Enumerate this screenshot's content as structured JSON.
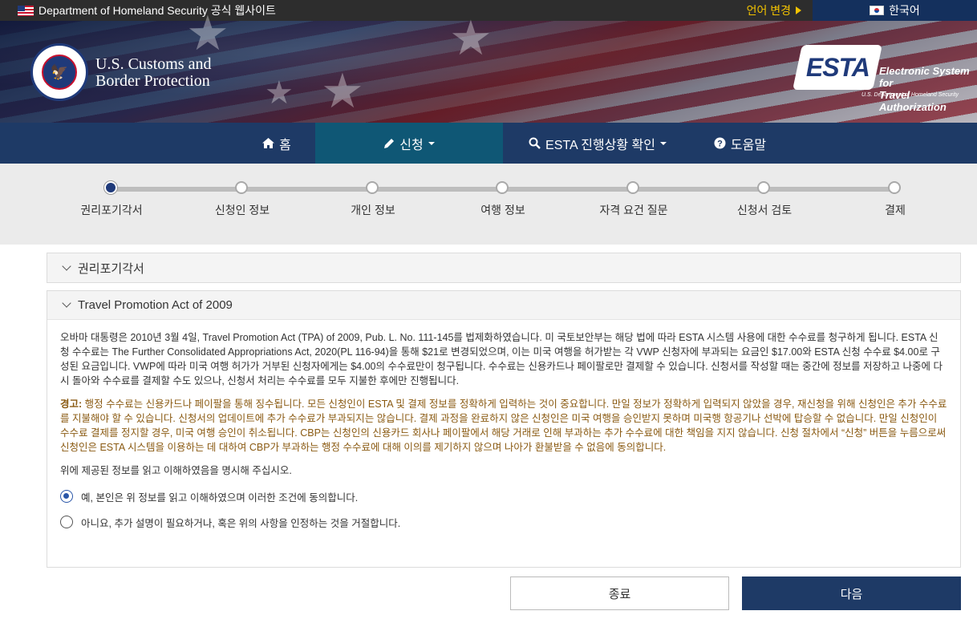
{
  "topbar": {
    "official_site": "Department of Homeland Security 공식 웹사이트",
    "language_change": "언어 변경",
    "current_language": "한국어"
  },
  "header": {
    "agency_line1": "U.S. Customs and",
    "agency_line2": "Border Protection",
    "esta_logo": "ESTA",
    "esta_line1": "Electronic System for",
    "esta_line2": "Travel Authorization",
    "esta_sub": "U.S. Department of Homeland Security"
  },
  "nav": {
    "home": "홈",
    "apply": "신청",
    "status": "ESTA 진행상황 확인",
    "help": "도움말"
  },
  "steps": [
    "권리포기각서",
    "신청인 정보",
    "개인 정보",
    "여행 정보",
    "자격 요건 질문",
    "신청서 검토",
    "결제"
  ],
  "panels": {
    "waiver_title": "권리포기각서",
    "tpa_title": "Travel Promotion Act of 2009",
    "paragraph": "오바마 대통령은 2010년 3월 4일, Travel Promotion Act (TPA) of 2009, Pub. L. No. 111-145를 법제화하였습니다. 미 국토보안부는 해당 법에 따라 ESTA 시스템 사용에 대한 수수료를 청구하게 됩니다. ESTA 신청 수수료는 The Further Consolidated Appropriations Act, 2020(PL 116-94)을 통해 $21로 변경되었으며, 이는 미국 여행을 허가받는 각 VWP 신청자에 부과되는 요금인 $17.00와 ESTA 신청 수수료 $4.00로 구성된 요금입니다. VWP에 따라 미국 여행 허가가 거부된 신청자에게는 $4.00의 수수료만이 청구됩니다. 수수료는 신용카드나 페이팔로만 결제할 수 있습니다. 신청서를 작성할 때는 중간에 정보를 저장하고 나중에 다시 돌아와 수수료를 결제할 수도 있으나, 신청서 처리는 수수료를 모두 지불한 후에만 진행됩니다.",
    "warning_label": "경고:",
    "warning_text": " 행정 수수료는 신용카드나 페이팔을 통해 징수됩니다. 모든 신청인이 ESTA 및 결제 정보를 정확하게 입력하는 것이 중요합니다. 만일 정보가 정확하게 입력되지 않았을 경우, 재신청을 위해 신청인은 추가 수수료를 지불해야 할 수 있습니다. 신청서의 업데이트에 추가 수수료가 부과되지는 않습니다. 결제 과정을 완료하지 않은 신청인은 미국 여행을 승인받지 못하며 미국행 항공기나 선박에 탑승할 수 없습니다. 만일 신청인이 수수료 결제를 정지할 경우, 미국 여행 승인이 취소됩니다. CBP는 신청인의 신용카드 회사나 페이팔에서 해당 거래로 인해 부과하는 추가 수수료에 대한 책임을 지지 않습니다. 신청 절차에서 “신청” 버튼을 누름으로써 신청인은 ESTA 시스템을 이용하는 데 대하여 CBP가 부과하는 행정 수수료에 대해 이의를 제기하지 않으며 나아가 환불받을 수 없음에 동의합니다.",
    "ask": "위에 제공된 정보를 읽고 이해하였음을 명시해 주십시오.",
    "option_yes": "예, 본인은 위 정보를 읽고 이해하였으며 이러한 조건에 동의합니다.",
    "option_no": "아니요, 추가 설명이 필요하거나, 혹은 위의 사항을 인정하는 것을 거절합니다.",
    "selected_option": "option_yes"
  },
  "buttons": {
    "exit": "종료",
    "next": "다음"
  },
  "colors": {
    "nav_bg": "#1e3a66",
    "nav_active": "#0f5775",
    "warning_text": "#8a5a12",
    "accent": "#f3c300"
  },
  "current_step": 1
}
